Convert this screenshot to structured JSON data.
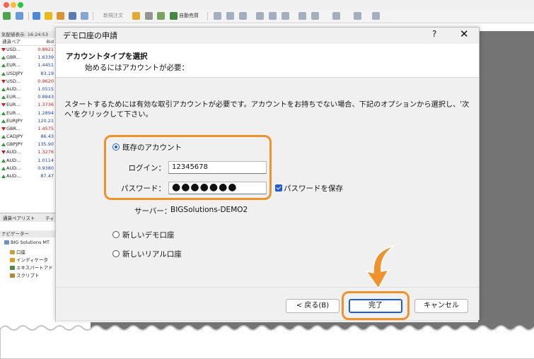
{
  "app": {
    "toolbar": {
      "new_order_label": "新規注文",
      "auto_trade_label": "自動売買"
    },
    "market_watch": {
      "header": "気配値表示: 16:24:53",
      "col_symbol": "通貨ペア",
      "col_bid": "Bid",
      "rows": [
        {
          "symbol": "USD...",
          "bid": "0.8921",
          "dir": "down"
        },
        {
          "symbol": "GBR...",
          "bid": "1.6339",
          "dir": "up"
        },
        {
          "symbol": "EUR...",
          "bid": "1.4451",
          "dir": "up"
        },
        {
          "symbol": "USDJPY",
          "bid": "83.19",
          "dir": "up"
        },
        {
          "symbol": "USD...",
          "bid": "0.9620",
          "dir": "down"
        },
        {
          "symbol": "AUD...",
          "bid": "1.0515",
          "dir": "up"
        },
        {
          "symbol": "EUR...",
          "bid": "0.8843",
          "dir": "up"
        },
        {
          "symbol": "EUR...",
          "bid": "1.3736",
          "dir": "down"
        },
        {
          "symbol": "EUR...",
          "bid": "1.2894",
          "dir": "up"
        },
        {
          "symbol": "EURJPY",
          "bid": "120.21",
          "dir": "up"
        },
        {
          "symbol": "GBR...",
          "bid": "1.4575",
          "dir": "down"
        },
        {
          "symbol": "CADJPY",
          "bid": "86.43",
          "dir": "up"
        },
        {
          "symbol": "GBPJPY",
          "bid": "135.90",
          "dir": "up"
        },
        {
          "symbol": "AUD...",
          "bid": "1.3276",
          "dir": "down"
        },
        {
          "symbol": "AUD...",
          "bid": "1.0114",
          "dir": "up"
        },
        {
          "symbol": "AUD...",
          "bid": "0.9380",
          "dir": "up"
        },
        {
          "symbol": "AUD...",
          "bid": "87.47",
          "dir": "up"
        }
      ],
      "tab_list": "通貨ペアリスト",
      "tab_tick": "ティ"
    },
    "navigator": {
      "header": "ナビゲーター",
      "root": "BIG Solutions MT",
      "items": [
        "口座",
        "インディケータ",
        "エキスパートアド",
        "スクリプト"
      ]
    }
  },
  "dialog": {
    "title": "デモ口座の申請",
    "help": "?",
    "close": "✕",
    "heading": "アカウントタイプを選択",
    "subheading": "始めるにはアカウントが必要：",
    "description": "スタートするためには有効な取引アカウントが必要です。アカウントをお持ちでない場合、下記のオプションから選択し、'次へ'をクリックして下さい。",
    "options": {
      "existing": "既存のアカウント",
      "new_demo": "新しいデモ口座",
      "new_real": "新しいリアル口座"
    },
    "login_label": "ログイン：",
    "login_value": "12345678",
    "password_label": "パスワード：",
    "password_value": "●●●●●●●",
    "save_password_label": "パスワードを保存",
    "server_label": "サーバー：",
    "server_value": "BIGSolutions-DEMO2",
    "buttons": {
      "back": "< 戻る(B)",
      "finish": "完了",
      "cancel": "キャンセル"
    }
  },
  "colors": {
    "accent_blue": "#1e5bd6",
    "highlight_orange": "#f0922b",
    "bid_up": "#1f3fbf",
    "bid_down": "#d11a1a"
  }
}
